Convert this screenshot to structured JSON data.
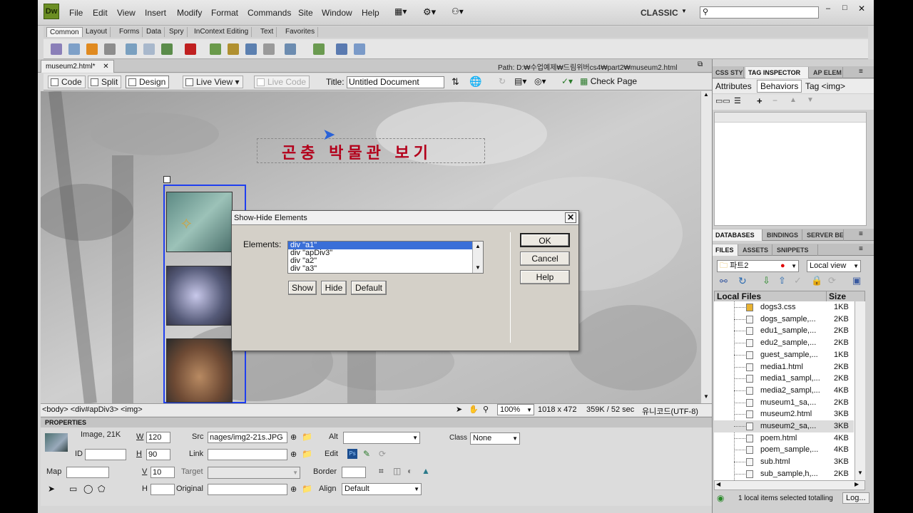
{
  "app": {
    "logo": "Dw",
    "menu": [
      "File",
      "Edit",
      "View",
      "Insert",
      "Modify",
      "Format",
      "Commands",
      "Site",
      "Window",
      "Help"
    ],
    "workspace": "CLASSIC",
    "search_placeholder": ""
  },
  "insert_tabs": [
    "Common",
    "Layout",
    "Forms",
    "Data",
    "Spry",
    "InContext Editing",
    "Text",
    "Favorites"
  ],
  "document": {
    "tab_label": "museum2.html*",
    "path": "Path:  D:₩수업예제₩드림위버cs4₩part2₩museum2.html",
    "views": {
      "code": "Code",
      "split": "Split",
      "design": "Design",
      "live_view": "Live View",
      "live_code": "Live Code"
    },
    "title_label": "Title:",
    "title_value": "Untitled Document",
    "check_page": "Check Page",
    "heading_text": "곤충 박물관 보기"
  },
  "statusbar": {
    "tag_path": "<body> <div#apDiv3> <img>",
    "zoom": "100%",
    "dims": "1018 x 472",
    "size": "359K / 52 sec",
    "encoding": "유니코드(UTF-8)"
  },
  "properties": {
    "header": "PROPERTIES",
    "image_info": "Image, 21K",
    "w_label": "W",
    "w_value": "120",
    "h_label": "H",
    "h_value": "90",
    "id_label": "ID",
    "src_label": "Src",
    "src_value": "nages/img2-21s.JPG",
    "link_label": "Link",
    "alt_label": "Alt",
    "edit_label": "Edit",
    "class_label": "Class",
    "class_value": "None",
    "map_label": "Map",
    "v_label": "V",
    "v_value": "10",
    "target_label": "Target",
    "border_label": "Border",
    "h2_label": "H",
    "original_label": "Original",
    "align_label": "Align",
    "align_value": "Default"
  },
  "right_panel": {
    "top_tabs": [
      "CSS STY",
      "TAG INSPECTOR",
      "AP ELEM"
    ],
    "sub_tabs": [
      "Attributes",
      "Behaviors"
    ],
    "tag_label": "Tag <img>",
    "mid_tabs": [
      "DATABASES",
      "BINDINGS",
      "SERVER BE"
    ],
    "files_tabs": [
      "FILES",
      "ASSETS",
      "SNIPPETS"
    ],
    "site_name": "파트2",
    "view_select": "Local view",
    "col_local": "Local Files",
    "col_size": "Size",
    "files": [
      {
        "name": "dogs3.css",
        "size": "1KB"
      },
      {
        "name": "dogs_sample,...",
        "size": "2KB"
      },
      {
        "name": "edu1_sample,...",
        "size": "2KB"
      },
      {
        "name": "edu2_sample,...",
        "size": "2KB"
      },
      {
        "name": "guest_sample,...",
        "size": "1KB"
      },
      {
        "name": "media1.html",
        "size": "2KB"
      },
      {
        "name": "media1_sampl,...",
        "size": "2KB"
      },
      {
        "name": "media2_sampl,...",
        "size": "4KB"
      },
      {
        "name": "museum1_sa,...",
        "size": "2KB"
      },
      {
        "name": "museum2.html",
        "size": "3KB"
      },
      {
        "name": "museum2_sa,...",
        "size": "3KB"
      },
      {
        "name": "poem.html",
        "size": "4KB"
      },
      {
        "name": "poem_sample,...",
        "size": "4KB"
      },
      {
        "name": "sub.html",
        "size": "3KB"
      },
      {
        "name": "sub_sample,h,...",
        "size": "2KB"
      }
    ],
    "status": "1 local items selected totalling",
    "log_button": "Log..."
  },
  "dialog": {
    "title": "Show-Hide Elements",
    "elements_label": "Elements:",
    "items": [
      "div \"a1\"",
      "div \"apDiv3\"",
      "div \"a2\"",
      "div \"a3\""
    ],
    "show": "Show",
    "hide": "Hide",
    "default": "Default",
    "ok": "OK",
    "cancel": "Cancel",
    "help": "Help"
  },
  "colors": {
    "accent": "#3a6fd8",
    "heading": "#b3001b",
    "selection_border": "#1f3ff0"
  }
}
